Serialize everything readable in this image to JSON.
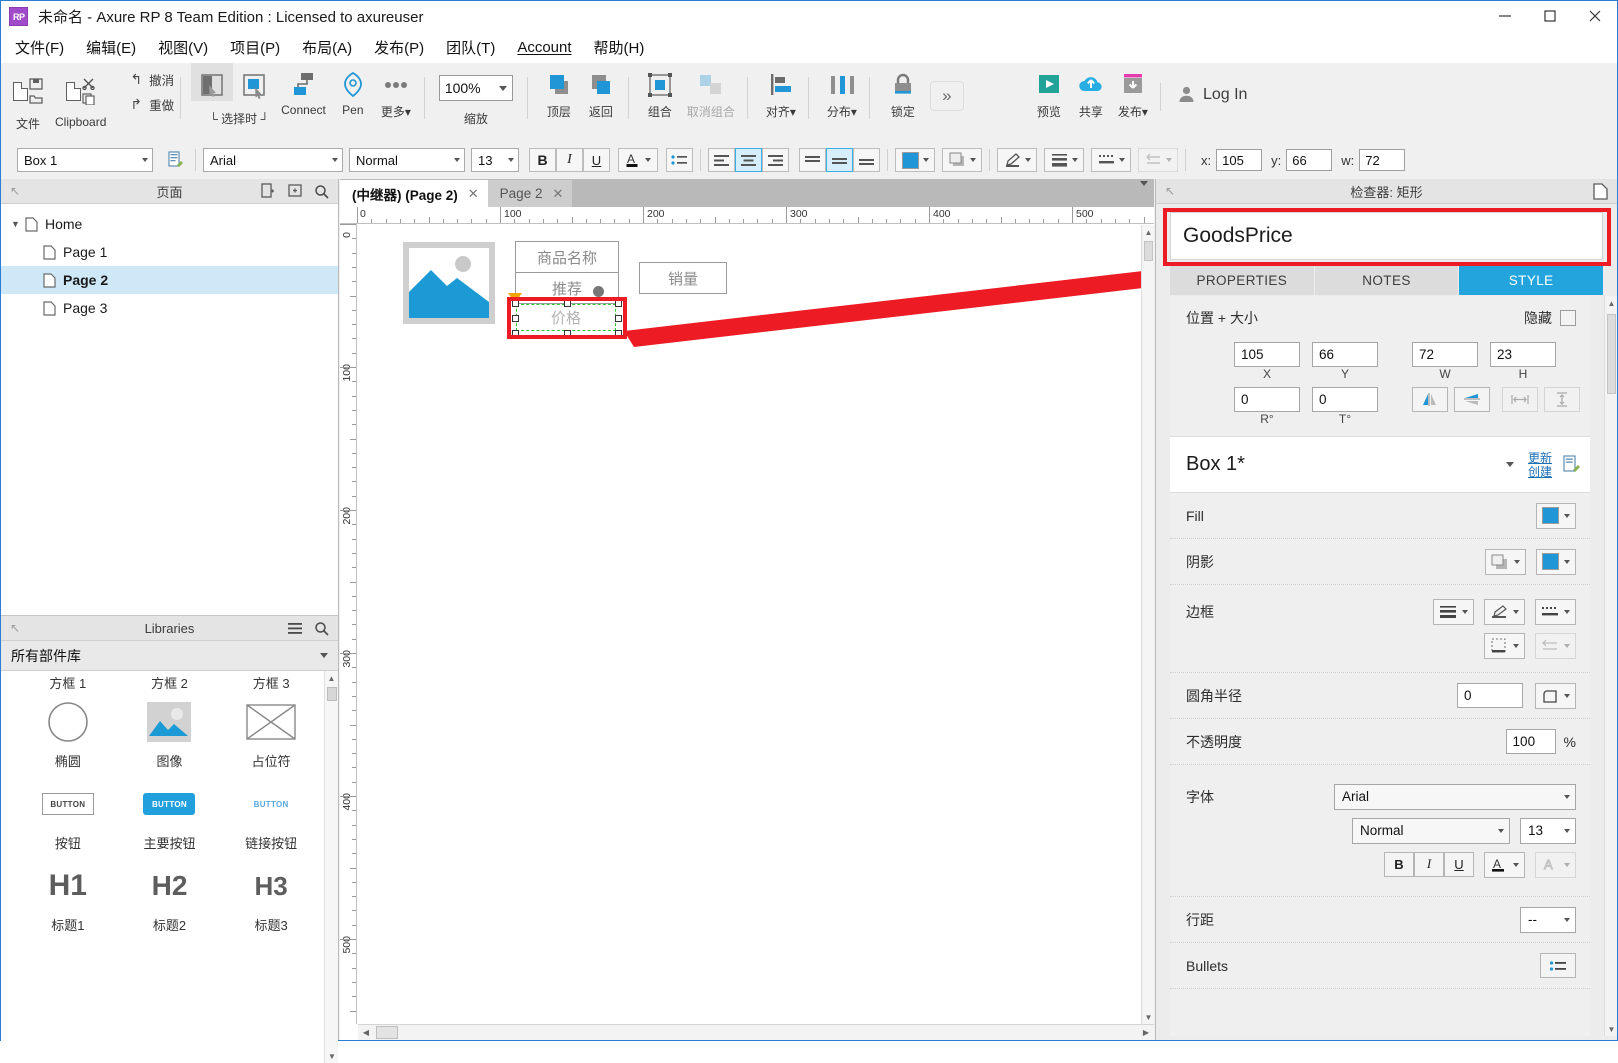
{
  "window": {
    "title": "未命名 - Axure RP 8 Team Edition : Licensed to axureuser",
    "logo_text": "RP",
    "minimize": "–",
    "maximize": "□",
    "close": "✕"
  },
  "menu": [
    {
      "label": "文件(F)"
    },
    {
      "label": "编辑(E)"
    },
    {
      "label": "视图(V)"
    },
    {
      "label": "项目(P)"
    },
    {
      "label": "布局(A)"
    },
    {
      "label": "发布(P)"
    },
    {
      "label": "团队(T)"
    },
    {
      "label": "Account"
    },
    {
      "label": "帮助(H)"
    }
  ],
  "toolbar": {
    "file": "文件",
    "clipboard": "Clipboard",
    "undo": "撤消",
    "redo": "重做",
    "select_mode": "└ 选择时 ┘",
    "connect": "Connect",
    "pen": "Pen",
    "more": "更多▾",
    "zoom_value": "100%",
    "zoom_label": "缩放",
    "bring_front": "顶层",
    "send_back": "返回",
    "group": "组合",
    "ungroup": "取消组合",
    "align": "对齐▾",
    "distribute": "分布▾",
    "lock": "锁定",
    "overflow": "»",
    "preview": "预览",
    "share": "共享",
    "publish": "发布▾",
    "login": "Log In"
  },
  "format_bar": {
    "widget_name": "Box 1",
    "font_family": "Arial",
    "font_weight": "Normal",
    "font_size": "13",
    "bold": "B",
    "italic": "I",
    "underline": "U",
    "font_color": "A",
    "bullets": "≔",
    "align_left": "≡",
    "align_center": "≡",
    "align_right": "≡",
    "valign_top": "=",
    "valign_middle": "=",
    "valign_bottom": "=",
    "x_label": "x:",
    "x_value": "105",
    "y_label": "y:",
    "y_value": "66",
    "w_label": "w:",
    "w_value": "72"
  },
  "pages_panel": {
    "title": "页面",
    "tree": [
      {
        "label": "Home",
        "level": 0,
        "selected": false,
        "expandable": true
      },
      {
        "label": "Page 1",
        "level": 1,
        "selected": false,
        "expandable": false
      },
      {
        "label": "Page 2",
        "level": 1,
        "selected": true,
        "expandable": false
      },
      {
        "label": "Page 3",
        "level": 1,
        "selected": false,
        "expandable": false
      }
    ]
  },
  "libraries_panel": {
    "title": "Libraries",
    "selector_value": "所有部件库",
    "items": [
      {
        "caption": "方框 1",
        "icon": "box-1-icon"
      },
      {
        "caption": "方框 2",
        "icon": "box-2-icon"
      },
      {
        "caption": "方框 3",
        "icon": "box-3-icon"
      },
      {
        "caption": "椭圆",
        "icon": "ellipse-icon"
      },
      {
        "caption": "图像",
        "icon": "image-icon"
      },
      {
        "caption": "占位符",
        "icon": "placeholder-icon"
      },
      {
        "caption": "按钮",
        "icon": "button-icon",
        "glyph": "BUTTON"
      },
      {
        "caption": "主要按钮",
        "icon": "primary-button-icon",
        "glyph": "BUTTON"
      },
      {
        "caption": "链接按钮",
        "icon": "link-button-icon",
        "glyph": "BUTTON"
      },
      {
        "caption": "标题1",
        "icon": "h1-icon",
        "glyph": "H1"
      },
      {
        "caption": "标题2",
        "icon": "h2-icon",
        "glyph": "H2"
      },
      {
        "caption": "标题3",
        "icon": "h3-icon",
        "glyph": "H3"
      }
    ]
  },
  "canvas": {
    "tabs": [
      {
        "label": "(中继器) (Page 2)",
        "active": true,
        "close": "✕"
      },
      {
        "label": "Page 2",
        "active": false,
        "close": "✕"
      }
    ],
    "ruler_h": [
      "0",
      "100",
      "200",
      "300",
      "400",
      "500"
    ],
    "ruler_v": [
      "0",
      "100",
      "200",
      "300",
      "400",
      "500"
    ],
    "widgets": [
      {
        "name": "image-widget",
        "text": ""
      },
      {
        "name": "goods-name-widget",
        "text": "商品名称"
      },
      {
        "name": "recommend-widget",
        "text": "推荐"
      },
      {
        "name": "sales-widget",
        "text": "销量"
      },
      {
        "name": "price-widget",
        "text": "价格",
        "selected": true
      }
    ]
  },
  "inspector": {
    "title": "检查器: 矩形",
    "widget_name": "GoodsPrice",
    "tabs": [
      {
        "label": "PROPERTIES",
        "active": false
      },
      {
        "label": "NOTES",
        "active": false
      },
      {
        "label": "STYLE",
        "active": true
      }
    ],
    "position_size": {
      "section_label": "位置 + 大小",
      "hide_label": "隐藏",
      "x": "105",
      "y": "66",
      "w": "72",
      "h": "23",
      "x_label": "X",
      "y_label": "Y",
      "w_label": "W",
      "h_label": "H",
      "rotation": "0",
      "text_rotation": "0",
      "r_label": "R°",
      "t_label": "T°"
    },
    "style_name": "Box 1*",
    "update_link": "更新",
    "create_link": "创建",
    "rows": [
      {
        "label": "Fill"
      },
      {
        "label": "阴影"
      },
      {
        "label": "边框"
      },
      {
        "label": "圆角半径",
        "value": "0"
      },
      {
        "label": "不透明度",
        "value": "100",
        "unit": "%"
      },
      {
        "label": "字体",
        "value": "Arial",
        "weight": "Normal",
        "size": "13"
      },
      {
        "label": "行距",
        "value": "--"
      },
      {
        "label": "Bullets"
      }
    ]
  },
  "colors": {
    "accent": "#24a4dd",
    "widget_blue": "#2196d6",
    "annotation_red": "#ed1c24",
    "selection_green": "#2fc72f",
    "selection_row": "#cfe8f7"
  }
}
